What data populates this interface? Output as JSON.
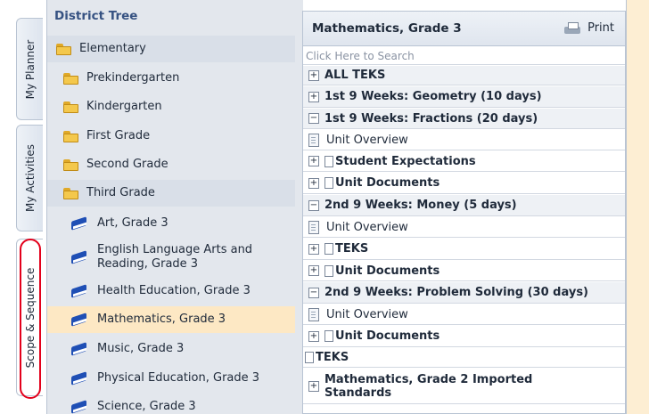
{
  "vertical_tabs": [
    "My Planner",
    "My Activities",
    "Scope & Sequence"
  ],
  "tree": {
    "title": "District Tree",
    "items": [
      {
        "label": "Elementary",
        "icon": "folder-icon"
      },
      {
        "label": "Prekindergarten",
        "icon": "folder-icon"
      },
      {
        "label": "Kindergarten",
        "icon": "folder-icon"
      },
      {
        "label": "First Grade",
        "icon": "folder-icon"
      },
      {
        "label": "Second Grade",
        "icon": "folder-icon"
      },
      {
        "label": "Third Grade",
        "icon": "folder-icon"
      },
      {
        "label": "Art, Grade 3",
        "icon": "book-icon"
      },
      {
        "label": "English Language Arts and Reading, Grade 3",
        "icon": "book-icon"
      },
      {
        "label": "Health Education, Grade 3",
        "icon": "book-icon"
      },
      {
        "label": "Mathematics, Grade 3",
        "icon": "book-icon"
      },
      {
        "label": "Music, Grade 3",
        "icon": "book-icon"
      },
      {
        "label": "Physical Education, Grade 3",
        "icon": "book-icon"
      },
      {
        "label": "Science, Grade 3",
        "icon": "book-icon"
      }
    ]
  },
  "scope": {
    "title": "Mathematics, Grade 3",
    "print_label": "Print",
    "search_placeholder": "Click Here to Search",
    "rows": [
      {
        "label": "ALL TEKS",
        "toggle": "⊞"
      },
      {
        "label": "1st 9 Weeks: Geometry (10 days)",
        "toggle": "⊞"
      },
      {
        "label": "1st 9 Weeks: Fractions (20 days)",
        "toggle": "⊟"
      },
      {
        "label": "Unit Overview"
      },
      {
        "label": "Student Expectations",
        "toggle": "⊞"
      },
      {
        "label": "Unit Documents",
        "toggle": "⊞"
      },
      {
        "label": "2nd 9 Weeks: Money (5 days)",
        "toggle": "⊟"
      },
      {
        "label": "Unit Overview"
      },
      {
        "label": "TEKS",
        "toggle": "⊞"
      },
      {
        "label": "Unit Documents",
        "toggle": "⊞"
      },
      {
        "label": "2nd 9 Weeks: Problem Solving (30 days)",
        "toggle": "⊟"
      },
      {
        "label": "Unit Overview"
      },
      {
        "label": "Unit Documents",
        "toggle": "⊞"
      },
      {
        "label": "TEKS"
      },
      {
        "label": "Mathematics, Grade 2 Imported Standards",
        "toggle": "⊞"
      }
    ]
  },
  "colors": {
    "accent": "#365282",
    "selected": "#fde8c4",
    "highlight": "#e3001b"
  }
}
